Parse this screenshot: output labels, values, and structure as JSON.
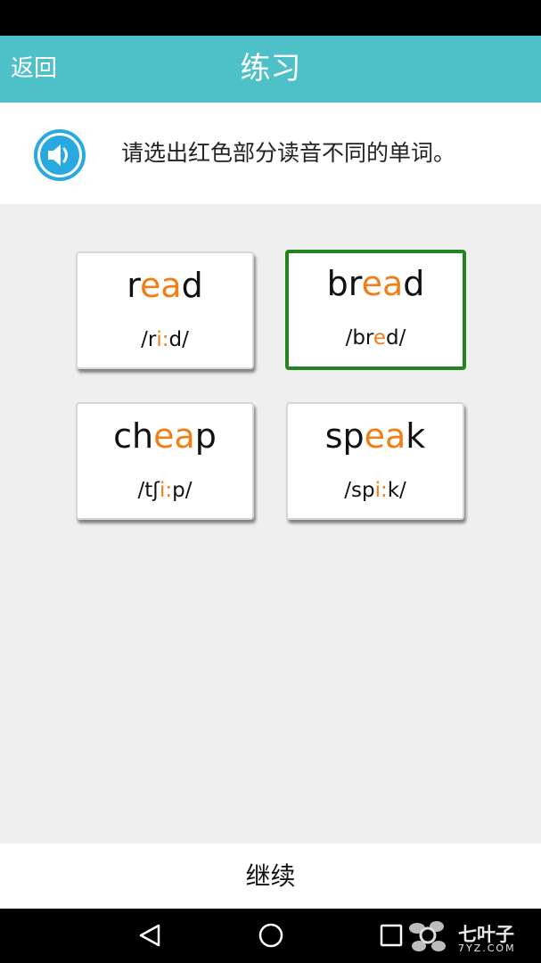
{
  "app_bar": {
    "back_label": "返回",
    "title": "练习",
    "color": "#4ec0c7"
  },
  "prompt": {
    "text": "请选出红色部分读音不同的单词。",
    "icon": "speaker-icon"
  },
  "highlight_color": "#f07f17",
  "selected_border_color": "#23841e",
  "options": [
    {
      "pre": "r",
      "hl": "ea",
      "post": "d",
      "ipa_pre": "/r",
      "ipa_hl": "i:",
      "ipa_post": "d/",
      "selected": false
    },
    {
      "pre": "br",
      "hl": "ea",
      "post": "d",
      "ipa_pre": "/br",
      "ipa_hl": "e",
      "ipa_post": "d/",
      "selected": true
    },
    {
      "pre": "ch",
      "hl": "ea",
      "post": "p",
      "ipa_pre": "/tʃ",
      "ipa_hl": "i:",
      "ipa_post": "p/",
      "selected": false
    },
    {
      "pre": "sp",
      "hl": "ea",
      "post": "k",
      "ipa_pre": "/sp",
      "ipa_hl": "i:",
      "ipa_post": "k/",
      "selected": false
    }
  ],
  "continue_label": "继续",
  "nav": {
    "back_icon": "back-triangle-icon",
    "home_icon": "home-circle-icon",
    "recents_icon": "recents-square-icon"
  },
  "watermark": {
    "text": "七叶子",
    "url": "7YZ.COM"
  }
}
